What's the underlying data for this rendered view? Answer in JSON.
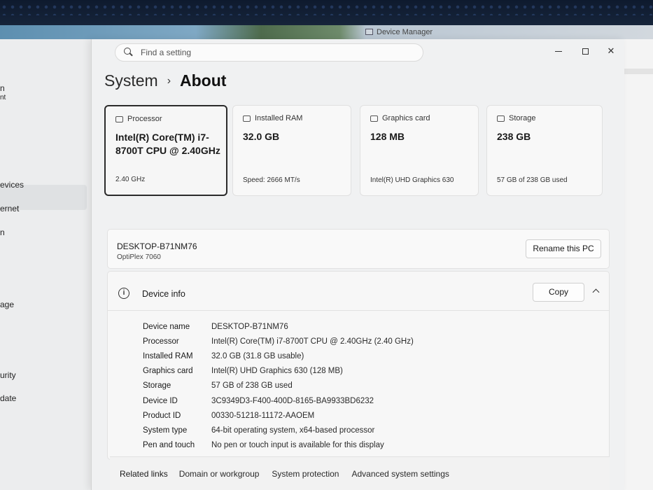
{
  "background": {
    "device_manager_title": "Device Manager",
    "left_items": [
      "n",
      "nt",
      "evices",
      "ernet",
      "n",
      "age",
      "urity",
      "date"
    ]
  },
  "search": {
    "placeholder": "Find a setting"
  },
  "breadcrumb": {
    "parent": "System",
    "separator": "›",
    "current": "About"
  },
  "cards": [
    {
      "header": "Processor",
      "value": "Intel(R) Core(TM) i7-8700T CPU @ 2.40GHz",
      "footer": "2.40 GHz"
    },
    {
      "header": "Installed RAM",
      "value": "32.0 GB",
      "footer": "Speed: 2666 MT/s"
    },
    {
      "header": "Graphics card",
      "value": "128 MB",
      "footer": "Intel(R) UHD Graphics 630"
    },
    {
      "header": "Storage",
      "value": "238 GB",
      "footer": "57 GB of 238 GB used"
    }
  ],
  "pc": {
    "name": "DESKTOP-B71NM76",
    "model": "OptiPlex 7060",
    "rename_label": "Rename this PC"
  },
  "device_info": {
    "title": "Device info",
    "copy_label": "Copy",
    "rows": [
      {
        "label": "Device name",
        "value": "DESKTOP-B71NM76"
      },
      {
        "label": "Processor",
        "value": "Intel(R) Core(TM) i7-8700T CPU @ 2.40GHz (2.40 GHz)"
      },
      {
        "label": "Installed RAM",
        "value": "32.0 GB (31.8 GB usable)"
      },
      {
        "label": "Graphics card",
        "value": "Intel(R) UHD Graphics 630 (128 MB)"
      },
      {
        "label": "Storage",
        "value": "57 GB of 238 GB used"
      },
      {
        "label": "Device ID",
        "value": "3C9349D3-F400-400D-8165-BA9933BD6232"
      },
      {
        "label": "Product ID",
        "value": "00330-51218-11172-AAOEM"
      },
      {
        "label": "System type",
        "value": "64-bit operating system, x64-based processor"
      },
      {
        "label": "Pen and touch",
        "value": "No pen or touch input is available for this display"
      }
    ]
  },
  "related": {
    "title": "Related links",
    "links": [
      "Domain or workgroup",
      "System protection",
      "Advanced system settings"
    ]
  }
}
